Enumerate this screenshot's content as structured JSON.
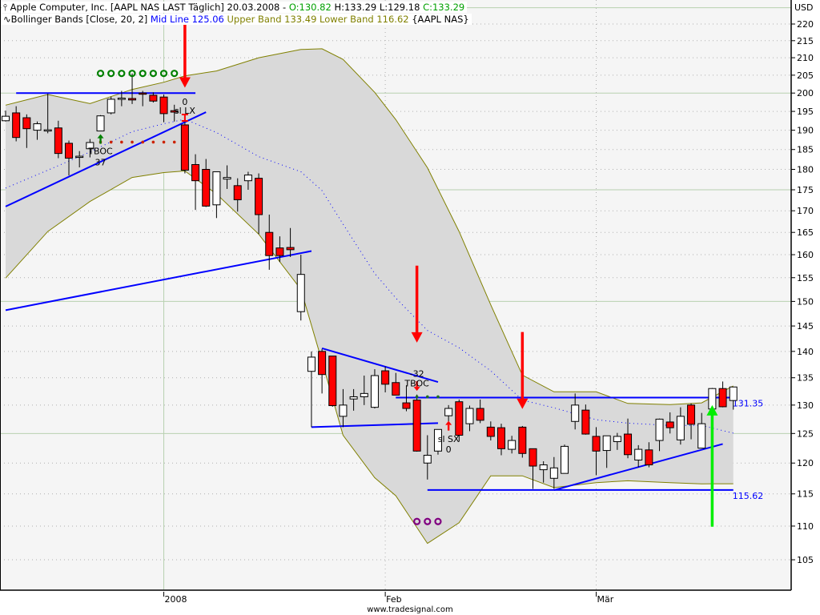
{
  "header": {
    "instrument": "Apple Computer, Inc. [AAPL NAS LAST Täglich] 20.03.2008 - ",
    "open": "O:130.82",
    "high": "H:133.29",
    "low": "L:129.18",
    "close": "C:133.29",
    "indicator": "Bollinger Bands [Close, 20, 2]",
    "mid_line": "Mid Line 125.06",
    "bands": "Upper Band 133.49 Lower Band 116.62",
    "symbol": "{AAPL NAS}",
    "icon_instrument": "candlestick-icon",
    "icon_indicator": "wave-icon"
  },
  "footer": {
    "watermark": "www.tradesignal.com"
  },
  "colors": {
    "up": "#ffffff",
    "down": "#ff0000",
    "band_fill": "#d9d9d9",
    "band_line": "#808000",
    "mid_line": "#0000ff",
    "trend_line": "#0000ff",
    "plot_bg": "#f5f5f5",
    "green": "#00a000",
    "signal_green": "#00ee00",
    "purple": "#800080"
  },
  "chart_data": {
    "type": "candlestick",
    "title": "Apple Computer, Inc. [AAPL NAS LAST Täglich]",
    "ylabel": "USD",
    "y_scale": "log",
    "ylim": [
      101,
      226
    ],
    "y_ticks": [
      220,
      215,
      210,
      205,
      200,
      195,
      190,
      185,
      180,
      175,
      170,
      165,
      160,
      155,
      150,
      145,
      140,
      135,
      130,
      125,
      120,
      115,
      110,
      105
    ],
    "y_major": [
      225,
      200,
      175,
      150,
      125
    ],
    "x_ticks": [
      {
        "date": "2008-01-02",
        "label": "2008"
      },
      {
        "date": "2008-02-01",
        "label": "Feb"
      },
      {
        "date": "2008-03-03",
        "label": "Mär"
      }
    ],
    "grid": true,
    "candles": [
      [
        "2007-12-10",
        192.5,
        195.2,
        192.3,
        193.7
      ],
      [
        "2007-12-11",
        194.6,
        196.4,
        187.1,
        188.1
      ],
      [
        "2007-12-12",
        193.3,
        194.2,
        185.4,
        190.4
      ],
      [
        "2007-12-13",
        190.0,
        192.3,
        187.5,
        191.7
      ],
      [
        "2007-12-14",
        190.1,
        199.8,
        189.2,
        190.1
      ],
      [
        "2007-12-17",
        190.6,
        192.5,
        182.8,
        184.0
      ],
      [
        "2007-12-18",
        186.6,
        187.3,
        178.5,
        182.8
      ],
      [
        "2007-12-19",
        183.2,
        184.6,
        180.5,
        183.3
      ],
      [
        "2007-12-20",
        185.2,
        187.7,
        183.0,
        186.8
      ],
      [
        "2007-12-21",
        189.8,
        194.0,
        189.8,
        193.8
      ],
      [
        "2007-12-24",
        194.6,
        199.0,
        194.2,
        198.3
      ],
      [
        "2007-12-26",
        198.4,
        200.6,
        196.4,
        198.6
      ],
      [
        "2007-12-27",
        198.5,
        205.5,
        197.0,
        198.1
      ],
      [
        "2007-12-28",
        200.0,
        200.6,
        196.4,
        199.8
      ],
      [
        "2007-12-31",
        199.4,
        200.2,
        197.4,
        197.8
      ],
      [
        "2008-01-02",
        198.9,
        199.6,
        192.1,
        194.4
      ],
      [
        "2008-01-03",
        195.2,
        196.8,
        192.3,
        194.8
      ],
      [
        "2008-01-04",
        191.4,
        192.1,
        179.0,
        179.8
      ],
      [
        "2008-01-07",
        181.2,
        183.8,
        170.2,
        177.2
      ],
      [
        "2008-01-08",
        180.0,
        182.6,
        170.9,
        171.1
      ],
      [
        "2008-01-09",
        171.4,
        179.4,
        168.3,
        179.4
      ],
      [
        "2008-01-10",
        177.6,
        181.0,
        175.2,
        178.0
      ],
      [
        "2008-01-11",
        176.0,
        177.8,
        169.8,
        172.6
      ],
      [
        "2008-01-14",
        177.2,
        179.4,
        175.0,
        178.6
      ],
      [
        "2008-01-15",
        177.8,
        179.0,
        164.6,
        169.1
      ],
      [
        "2008-01-16",
        165.0,
        169.1,
        156.7,
        159.8
      ],
      [
        "2008-01-17",
        161.5,
        164.1,
        158.4,
        159.8
      ],
      [
        "2008-01-18",
        161.6,
        166.0,
        159.5,
        161.1
      ],
      [
        "2008-01-22",
        147.9,
        160.0,
        146.1,
        155.7
      ],
      [
        "2008-01-23",
        136.2,
        140.0,
        126.1,
        138.9
      ],
      [
        "2008-01-24",
        140.0,
        140.5,
        132.1,
        135.6
      ],
      [
        "2008-01-25",
        139.1,
        139.1,
        129.7,
        129.9
      ],
      [
        "2008-01-28",
        128.0,
        132.9,
        126.1,
        130.0
      ],
      [
        "2008-01-29",
        131.1,
        132.9,
        129.0,
        131.5
      ],
      [
        "2008-01-30",
        131.5,
        135.4,
        130.0,
        132.1
      ],
      [
        "2008-01-31",
        129.6,
        136.6,
        129.4,
        135.4
      ],
      [
        "2008-02-01",
        136.3,
        137.1,
        132.3,
        133.8
      ],
      [
        "2008-02-04",
        134.1,
        135.9,
        131.8,
        131.8
      ],
      [
        "2008-02-05",
        130.4,
        133.6,
        128.9,
        129.4
      ],
      [
        "2008-02-06",
        130.9,
        131.9,
        121.9,
        122.0
      ],
      [
        "2008-02-07",
        120.0,
        124.7,
        117.3,
        121.3
      ],
      [
        "2008-02-08",
        122.0,
        125.7,
        121.4,
        125.7
      ],
      [
        "2008-02-11",
        128.1,
        130.0,
        127.1,
        129.4
      ],
      [
        "2008-02-12",
        130.6,
        131.0,
        123.6,
        124.7
      ],
      [
        "2008-02-13",
        126.7,
        129.9,
        125.4,
        129.4
      ],
      [
        "2008-02-14",
        129.4,
        131.0,
        126.8,
        127.3
      ],
      [
        "2008-02-15",
        126.1,
        127.1,
        123.8,
        124.5
      ],
      [
        "2008-02-19",
        126.0,
        126.7,
        121.3,
        122.4
      ],
      [
        "2008-02-20",
        122.3,
        124.6,
        121.6,
        123.8
      ],
      [
        "2008-02-21",
        126.1,
        126.3,
        120.9,
        121.6
      ],
      [
        "2008-02-22",
        122.4,
        122.4,
        115.8,
        119.5
      ],
      [
        "2008-02-25",
        118.9,
        120.3,
        116.8,
        119.7
      ],
      [
        "2008-02-26",
        117.5,
        121.0,
        115.8,
        119.2
      ],
      [
        "2008-02-27",
        118.3,
        123.1,
        118.3,
        122.8
      ],
      [
        "2008-02-28",
        127.1,
        132.1,
        125.7,
        130.0
      ],
      [
        "2008-02-29",
        129.1,
        130.1,
        124.8,
        124.9
      ],
      [
        "2008-03-03",
        124.5,
        126.1,
        118.0,
        122.0
      ],
      [
        "2008-03-04",
        122.1,
        124.6,
        119.2,
        124.6
      ],
      [
        "2008-03-05",
        123.6,
        125.1,
        122.2,
        124.5
      ],
      [
        "2008-03-06",
        124.9,
        127.6,
        120.8,
        121.4
      ],
      [
        "2008-03-07",
        120.5,
        123.0,
        119.3,
        122.3
      ],
      [
        "2008-03-10",
        122.2,
        123.5,
        119.3,
        119.7
      ],
      [
        "2008-03-11",
        123.8,
        127.6,
        122.0,
        127.5
      ],
      [
        "2008-03-12",
        127.0,
        128.7,
        125.0,
        126.0
      ],
      [
        "2008-03-13",
        123.9,
        129.6,
        123.1,
        128.0
      ],
      [
        "2008-03-14",
        130.0,
        130.3,
        124.0,
        126.6
      ],
      [
        "2008-03-17",
        122.5,
        128.6,
        122.5,
        126.7
      ],
      [
        "2008-03-18",
        129.3,
        133.1,
        128.6,
        133.0
      ],
      [
        "2008-03-19",
        133.0,
        134.3,
        129.6,
        129.7
      ],
      [
        "2008-03-20",
        130.82,
        133.29,
        129.18,
        133.29
      ]
    ],
    "bollinger": [
      [
        "2007-12-10",
        196.7,
        175.4,
        154.9
      ],
      [
        "2007-12-14",
        199.6,
        179.8,
        165.2
      ],
      [
        "2007-12-20",
        197.1,
        184.4,
        172.2
      ],
      [
        "2007-12-27",
        201.0,
        189.6,
        178.0
      ],
      [
        "2008-01-02",
        203.0,
        191.7,
        179.2
      ],
      [
        "2008-01-04",
        204.8,
        192.9,
        179.6
      ],
      [
        "2008-01-09",
        206.2,
        189.4,
        174.0
      ],
      [
        "2008-01-15",
        210.0,
        183.2,
        164.6
      ],
      [
        "2008-01-22",
        212.4,
        179.4,
        152.5
      ],
      [
        "2008-01-24",
        212.6,
        174.8,
        138.1
      ],
      [
        "2008-01-28",
        209.5,
        166.9,
        124.7
      ],
      [
        "2008-01-31",
        200.2,
        155.9,
        117.6
      ],
      [
        "2008-02-04",
        192.8,
        150.7,
        114.7
      ],
      [
        "2008-02-07",
        180.4,
        144.1,
        107.4
      ],
      [
        "2008-02-12",
        165.2,
        140.7,
        110.5
      ],
      [
        "2008-02-15",
        149.3,
        136.3,
        117.9
      ],
      [
        "2008-02-21",
        135.5,
        130.9,
        117.9
      ],
      [
        "2008-02-26",
        132.4,
        129.5,
        116.0
      ],
      [
        "2008-03-03",
        132.4,
        127.4,
        116.8
      ],
      [
        "2008-03-06",
        130.3,
        126.8,
        117.1
      ],
      [
        "2008-03-12",
        130.1,
        126.4,
        116.8
      ],
      [
        "2008-03-17",
        130.4,
        126.4,
        116.6
      ],
      [
        "2008-03-20",
        133.49,
        125.06,
        116.62
      ]
    ],
    "trend_lines": [
      {
        "points": [
          [
            "2007-12-11",
            200.0
          ],
          [
            "2008-01-07",
            200.0
          ]
        ]
      },
      {
        "points": [
          [
            "2007-12-10",
            171.0
          ],
          [
            "2008-01-08",
            194.8
          ]
        ]
      },
      {
        "points": [
          [
            "2007-12-10",
            148.2
          ],
          [
            "2008-01-23",
            160.8
          ]
        ]
      },
      {
        "points": [
          [
            "2008-01-24",
            140.6
          ],
          [
            "2008-02-08",
            134.2
          ]
        ]
      },
      {
        "points": [
          [
            "2008-01-23",
            126.1
          ],
          [
            "2008-02-08",
            126.8
          ]
        ]
      },
      {
        "points": [
          [
            "2008-02-04",
            131.35
          ],
          [
            "2008-03-20",
            131.35
          ]
        ],
        "label": "131.35"
      },
      {
        "points": [
          [
            "2008-02-07",
            115.62
          ],
          [
            "2008-03-20",
            115.62
          ]
        ],
        "label": "115.62"
      },
      {
        "points": [
          [
            "2008-02-26",
            115.6
          ],
          [
            "2008-03-19",
            123.2
          ]
        ]
      }
    ],
    "arrows": [
      {
        "date": "2008-01-04",
        "from": 220,
        "to": 201.5,
        "color": "#ff0000",
        "direction": "down"
      },
      {
        "date": "2008-02-06",
        "from": 157.6,
        "to": 141.7,
        "color": "#ff0000",
        "direction": "down"
      },
      {
        "date": "2008-02-21",
        "from": 143.8,
        "to": 129.3,
        "color": "#ff0000",
        "direction": "down"
      },
      {
        "date": "2008-03-18",
        "from": 109.9,
        "to": 130.0,
        "color": "#00ee00",
        "direction": "up"
      }
    ],
    "markers": [
      {
        "shape": "ring",
        "color": "#008000",
        "price": 205.5,
        "dates": [
          "2007-12-21",
          "2007-12-24",
          "2007-12-26",
          "2007-12-27",
          "2007-12-28",
          "2007-12-31",
          "2008-01-02",
          "2008-01-03"
        ]
      },
      {
        "shape": "dot",
        "color": "#cc2200",
        "price": 186.9,
        "dates": [
          "2007-12-21",
          "2007-12-24",
          "2007-12-26",
          "2007-12-27",
          "2007-12-28",
          "2007-12-31",
          "2008-01-02",
          "2008-01-03"
        ]
      },
      {
        "shape": "ring",
        "color": "#800080",
        "price": 110.7,
        "dates": [
          "2008-02-06",
          "2008-02-07",
          "2008-02-08"
        ]
      },
      {
        "shape": "dot",
        "color": "#207020",
        "price": 131.5,
        "dates": [
          "2008-02-06",
          "2008-02-07",
          "2008-02-08"
        ]
      }
    ],
    "signals": [
      {
        "date": "2007-12-21",
        "price": 187.5,
        "type": "small-up-arrow",
        "color": "#008000"
      },
      {
        "date": "2008-01-04",
        "price": 193.3,
        "type": "exit-marker",
        "color": "#ff0000"
      },
      {
        "date": "2008-02-06",
        "price": 133.6,
        "type": "small-down-arrow",
        "color": "#ff0000"
      },
      {
        "date": "2008-02-11",
        "price": 126.2,
        "type": "small-up-arrow",
        "color": "#ff0000"
      }
    ],
    "annotations": [
      {
        "date": "2008-01-04",
        "price": 197.6,
        "text": "0"
      },
      {
        "date": "2008-01-04",
        "price": 195.2,
        "text": "sl LX"
      },
      {
        "date": "2007-12-21",
        "price": 184.6,
        "text": "TBOC"
      },
      {
        "date": "2007-12-21",
        "price": 181.8,
        "text": "37"
      },
      {
        "date": "2008-02-06",
        "price": 135.8,
        "text": "-32"
      },
      {
        "date": "2008-02-06",
        "price": 134.0,
        "text": "TBOC"
      },
      {
        "date": "2008-02-11",
        "price": 124.1,
        "text": "sl SX"
      },
      {
        "date": "2008-02-11",
        "price": 122.3,
        "text": "0"
      }
    ]
  }
}
